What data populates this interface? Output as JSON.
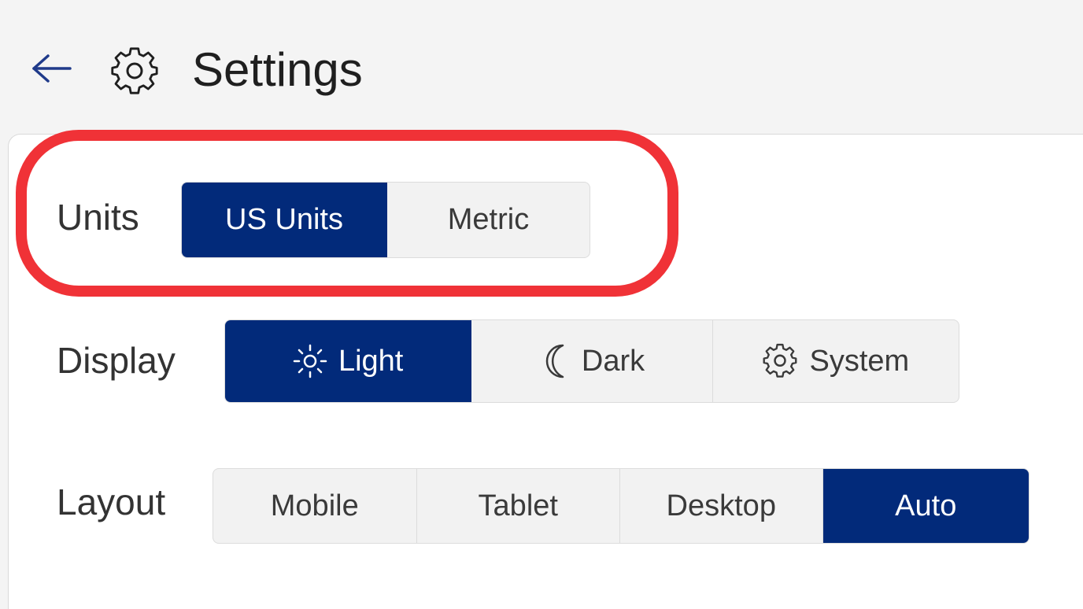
{
  "header": {
    "title": "Settings",
    "back_icon": "arrow-left-icon",
    "title_icon": "gear-icon"
  },
  "settings": {
    "units": {
      "label": "Units",
      "options": [
        {
          "label": "US Units",
          "selected": true
        },
        {
          "label": "Metric",
          "selected": false
        }
      ]
    },
    "display": {
      "label": "Display",
      "options": [
        {
          "label": "Light",
          "icon": "sun-icon",
          "selected": true
        },
        {
          "label": "Dark",
          "icon": "moon-icon",
          "selected": false
        },
        {
          "label": "System",
          "icon": "gear-icon",
          "selected": false
        }
      ]
    },
    "layout": {
      "label": "Layout",
      "options": [
        {
          "label": "Mobile",
          "selected": false
        },
        {
          "label": "Tablet",
          "selected": false
        },
        {
          "label": "Desktop",
          "selected": false
        },
        {
          "label": "Auto",
          "selected": true
        }
      ]
    }
  },
  "colors": {
    "accent": "#022a7a",
    "highlight": "#f03237",
    "background": "#f4f4f4",
    "panel": "#ffffff"
  }
}
